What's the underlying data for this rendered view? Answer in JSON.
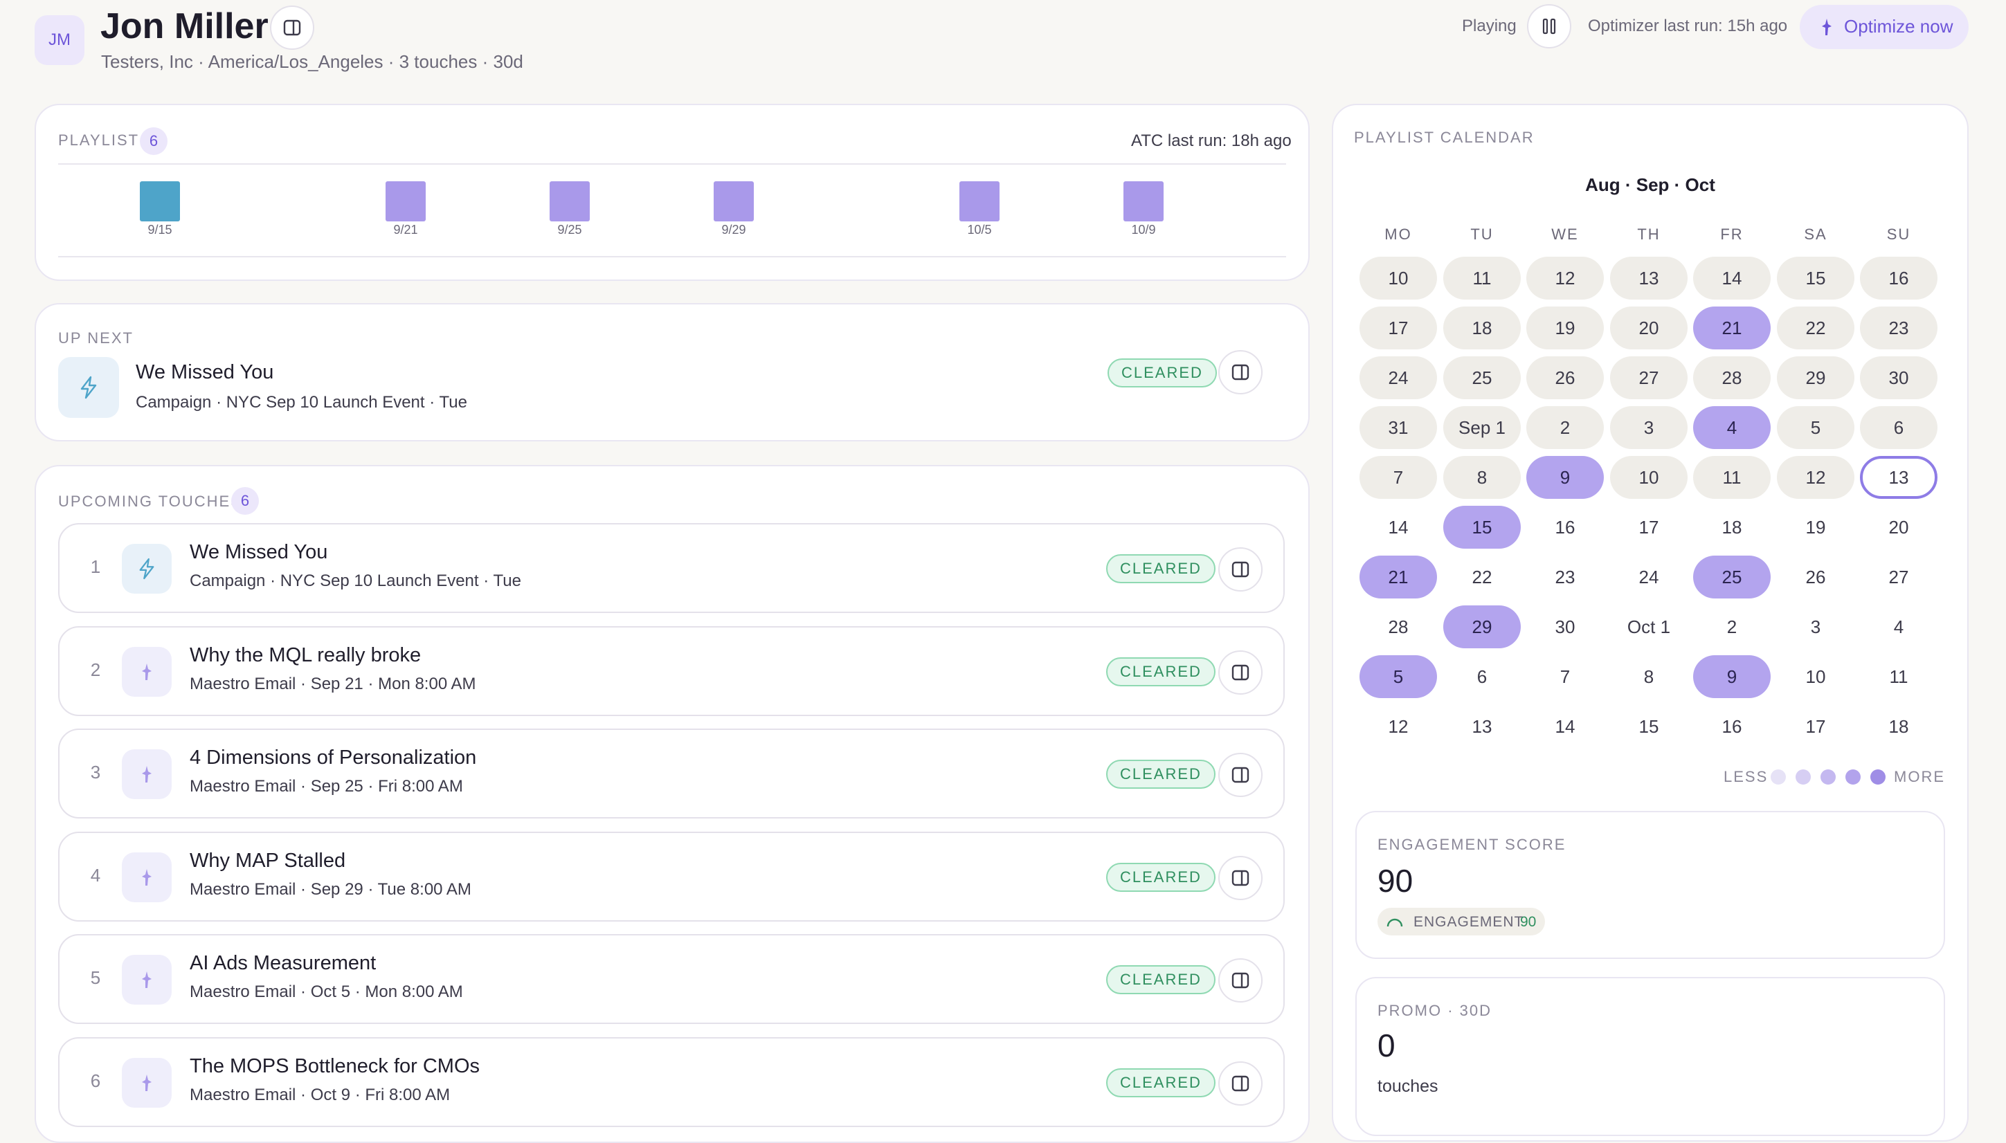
{
  "header": {
    "avatar_initials": "JM",
    "name": "Jon Miller",
    "subtitle": "Testers, Inc · America/Los_Angeles · 3 touches · 30d",
    "playing_label": "Playing",
    "optimizer_text": "Optimizer last run: 15h ago",
    "optimize_button": "Optimize now"
  },
  "playlist": {
    "label": "PLAYLIST",
    "count": "6",
    "atc_text": "ATC last run: 18h ago",
    "bars": [
      {
        "label": "9/15",
        "color": "#4ea4c9"
      },
      {
        "label": "9/21",
        "color": "#a999ea"
      },
      {
        "label": "9/25",
        "color": "#a999ea"
      },
      {
        "label": "9/29",
        "color": "#a999ea"
      },
      {
        "label": "10/5",
        "color": "#a999ea"
      },
      {
        "label": "10/9",
        "color": "#a999ea"
      }
    ]
  },
  "up_next": {
    "label": "UP NEXT",
    "title": "We Missed You",
    "subtitle": "Campaign · NYC Sep 10 Launch Event · Tue",
    "status": "CLEARED"
  },
  "upcoming": {
    "label": "UPCOMING TOUCHES",
    "count": "6",
    "items": [
      {
        "num": "1",
        "title": "We Missed You",
        "subtitle": "Campaign · NYC Sep 10 Launch Event · Tue",
        "status": "CLEARED",
        "icon": "lightning-icon"
      },
      {
        "num": "2",
        "title": "Why the MQL really broke",
        "subtitle": "Maestro Email · Sep 21 · Mon 8:00 AM",
        "status": "CLEARED",
        "icon": "maestro-icon"
      },
      {
        "num": "3",
        "title": "4 Dimensions of Personalization",
        "subtitle": "Maestro Email · Sep 25 · Fri 8:00 AM",
        "status": "CLEARED",
        "icon": "maestro-icon"
      },
      {
        "num": "4",
        "title": "Why MAP Stalled",
        "subtitle": "Maestro Email · Sep 29 · Tue 8:00 AM",
        "status": "CLEARED",
        "icon": "maestro-icon"
      },
      {
        "num": "5",
        "title": "AI Ads Measurement",
        "subtitle": "Maestro Email · Oct 5 · Mon 8:00 AM",
        "status": "CLEARED",
        "icon": "maestro-icon"
      },
      {
        "num": "6",
        "title": "The MOPS Bottleneck for CMOs",
        "subtitle": "Maestro Email · Oct 9 · Fri 8:00 AM",
        "status": "CLEARED",
        "icon": "maestro-icon"
      }
    ]
  },
  "calendar": {
    "label": "PLAYLIST CALENDAR",
    "range": "Aug · Sep · Oct",
    "weekdays": [
      "MO",
      "TU",
      "WE",
      "TH",
      "FR",
      "SA",
      "SU"
    ],
    "weeks": [
      [
        "10",
        "11",
        "12",
        "13",
        "14",
        "15",
        "16"
      ],
      [
        "17",
        "18",
        "19",
        "20",
        "21",
        "22",
        "23"
      ],
      [
        "24",
        "25",
        "26",
        "27",
        "28",
        "29",
        "30"
      ],
      [
        "31",
        "Sep 1",
        "2",
        "3",
        "4",
        "5",
        "6"
      ],
      [
        "7",
        "8",
        "9",
        "10",
        "11",
        "12",
        "13"
      ],
      [
        "14",
        "15",
        "16",
        "17",
        "18",
        "19",
        "20"
      ],
      [
        "21",
        "22",
        "23",
        "24",
        "25",
        "26",
        "27"
      ],
      [
        "28",
        "29",
        "30",
        "Oct 1",
        "2",
        "3",
        "4"
      ],
      [
        "5",
        "6",
        "7",
        "8",
        "9",
        "10",
        "11"
      ],
      [
        "12",
        "13",
        "14",
        "15",
        "16",
        "17",
        "18"
      ]
    ],
    "legend_less": "LESS",
    "legend_more": "MORE",
    "legend_colors": [
      "#e6e2f6",
      "#d6cef3",
      "#c4b8f0",
      "#b2a3ec",
      "#9f8de6"
    ]
  },
  "engagement": {
    "label": "ENGAGEMENT SCORE",
    "value": "90",
    "chip_label": "ENGAGEMENT",
    "chip_value": "90"
  },
  "promo": {
    "label": "PROMO · 30D",
    "value": "0",
    "unit": "touches"
  }
}
